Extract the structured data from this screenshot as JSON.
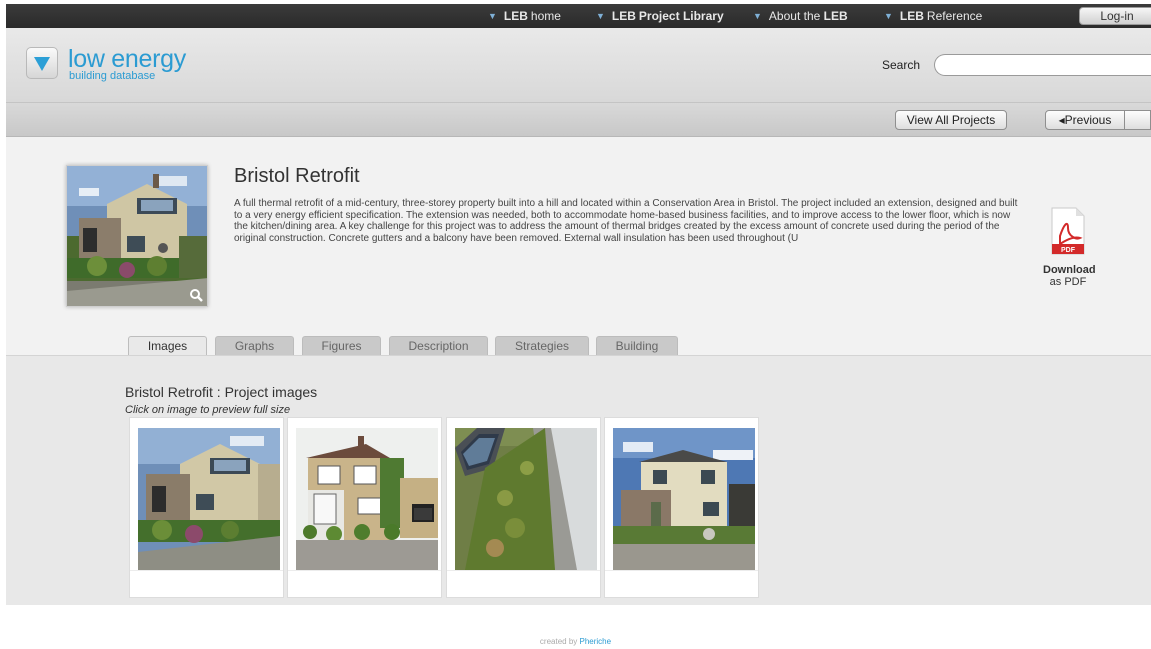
{
  "nav": {
    "items": [
      {
        "label": "LEB",
        "suffix": "home"
      },
      {
        "label": "LEB",
        "suffix": "Project Library"
      },
      {
        "label": "About the",
        "suffix": "LEB"
      },
      {
        "label": "LEB",
        "suffix": "Reference"
      }
    ],
    "login": "Log-in"
  },
  "logo": {
    "name": "low energy",
    "sub": "building database"
  },
  "search": {
    "label": "Search",
    "value": ""
  },
  "subbar": {
    "view_all": "View All Projects",
    "previous": "◂Previous"
  },
  "project": {
    "title": "Bristol Retrofit",
    "description": "A full thermal retrofit of a mid-century, three-storey property built into a hill and located within a Conservation Area in Bristol. The project included an extension, designed and built to a very energy efficient specification. The extension was needed, both to accommodate home-based business facilities, and to improve access to the lower floor, which is now the kitchen/dining area. A key challenge for this project was to address the amount of thermal bridges created by the excess amount of concrete used during the period of the original construction. Concrete gutters and a balcony have been removed. External wall insulation has been used throughout (U",
    "pdf_icon_text": "PDF",
    "download": "Download",
    "as_pdf": "as PDF"
  },
  "tabs": [
    "Images",
    "Graphs",
    "Figures",
    "Description",
    "Strategies",
    "Building"
  ],
  "content": {
    "title": "Bristol Retrofit : Project images",
    "subtitle": "Click on image to preview full size"
  },
  "footer": {
    "prefix": "created by",
    "brand": "Pheriche"
  },
  "colors": {
    "accent": "#2b9bd2",
    "nav_bg": "#333333"
  }
}
